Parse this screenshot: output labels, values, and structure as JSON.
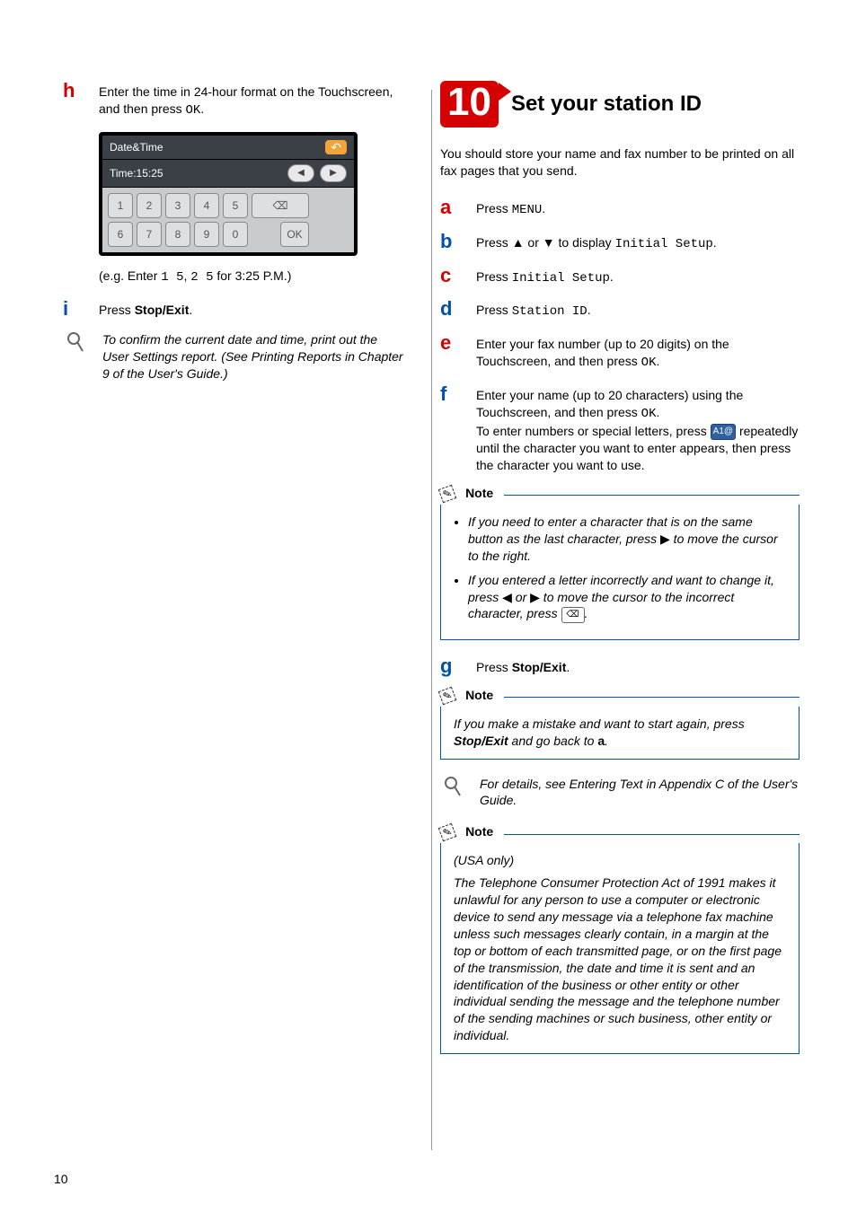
{
  "left": {
    "stepH": {
      "letter": "h",
      "color": "red",
      "text1": "Enter the time in 24-hour format on the Touchscreen, and then press ",
      "text2": "OK",
      "text3": "."
    },
    "touchscreen": {
      "title": "Date&Time",
      "time": "Time:15:25",
      "keys": [
        "1",
        "2",
        "3",
        "4",
        "5",
        "6",
        "7",
        "8",
        "9",
        "0"
      ],
      "ok": "OK"
    },
    "eg": {
      "prefix": "(e.g. Enter ",
      "seq1": "1 5",
      "mid": ", ",
      "seq2": "2 5",
      "suffix": " for 3:25 P.M.)"
    },
    "stepI": {
      "letter": "i",
      "color": "blue",
      "text1": "Press ",
      "text2": "Stop/Exit",
      "text3": "."
    },
    "hint": "To confirm the current date and time, print out the User Settings report. (See Printing Reports in Chapter 9 of the User's Guide.)"
  },
  "right": {
    "badge": "10",
    "title": "Set your station ID",
    "intro": "You should store your name and fax number to be printed on all fax pages that you send.",
    "stepA": {
      "letter": "a",
      "t1": "Press ",
      "t2": "MENU",
      "t3": "."
    },
    "stepB": {
      "letter": "b",
      "t1": "Press ",
      "tri_up": "▲",
      "t2": " or ",
      "tri_down": "▼",
      "t3": " to display ",
      "t4": "Initial Setup",
      "t5": "."
    },
    "stepC": {
      "letter": "c",
      "t1": "Press ",
      "t2": "Initial Setup",
      "t3": "."
    },
    "stepD": {
      "letter": "d",
      "t1": "Press ",
      "t2": "Station ID",
      "t3": "."
    },
    "stepE": {
      "letter": "e",
      "t1": "Enter your fax number (up to 20 digits) on the Touchscreen, and then press ",
      "t2": "OK",
      "t3": "."
    },
    "stepF": {
      "letter": "f",
      "t1": "Enter your name (up to 20 characters) using the Touchscreen, and then press ",
      "t2": "OK",
      "t3": ".",
      "t4": "To enter numbers or special letters, press ",
      "key": "A1@",
      "t5": " repeatedly until the character you want to enter appears, then press the character you want to use."
    },
    "note1_label": "Note",
    "note1": {
      "li1a": "If you need to enter a character that is on the same button as the last character, press ",
      "li1_tri": "▶",
      "li1b": " to move the cursor to the right.",
      "li2a": "If you entered a letter incorrectly and want to change it, press ",
      "li2_tri_l": "◀",
      "li2_or": " or ",
      "li2_tri_r": "▶",
      "li2b": " to move the cursor to the incorrect character, press ",
      "li2_key": "⌫",
      "li2c": "."
    },
    "stepG": {
      "letter": "g",
      "t1": "Press ",
      "t2": "Stop/Exit",
      "t3": "."
    },
    "note2_label": "Note",
    "note2": {
      "a": "If you make a mistake and want to start again, press ",
      "b": "Stop/Exit",
      "c": " and go back to ",
      "d": "a",
      "e": "."
    },
    "hint2": "For details, see Entering Text in Appendix C of the User's Guide.",
    "note3_label": "Note",
    "note3": {
      "head": "(USA only)",
      "body": "The Telephone Consumer Protection Act of 1991 makes it unlawful for any person to use a computer or electronic device to send any message via a telephone fax machine unless such messages clearly contain, in a margin at the top or bottom of each transmitted page, or on the first page of the transmission, the date and time it is sent and an identification of the business or other entity or other individual sending the message and the telephone number of the sending machines or such business, other entity or individual."
    }
  },
  "page_number": "10"
}
